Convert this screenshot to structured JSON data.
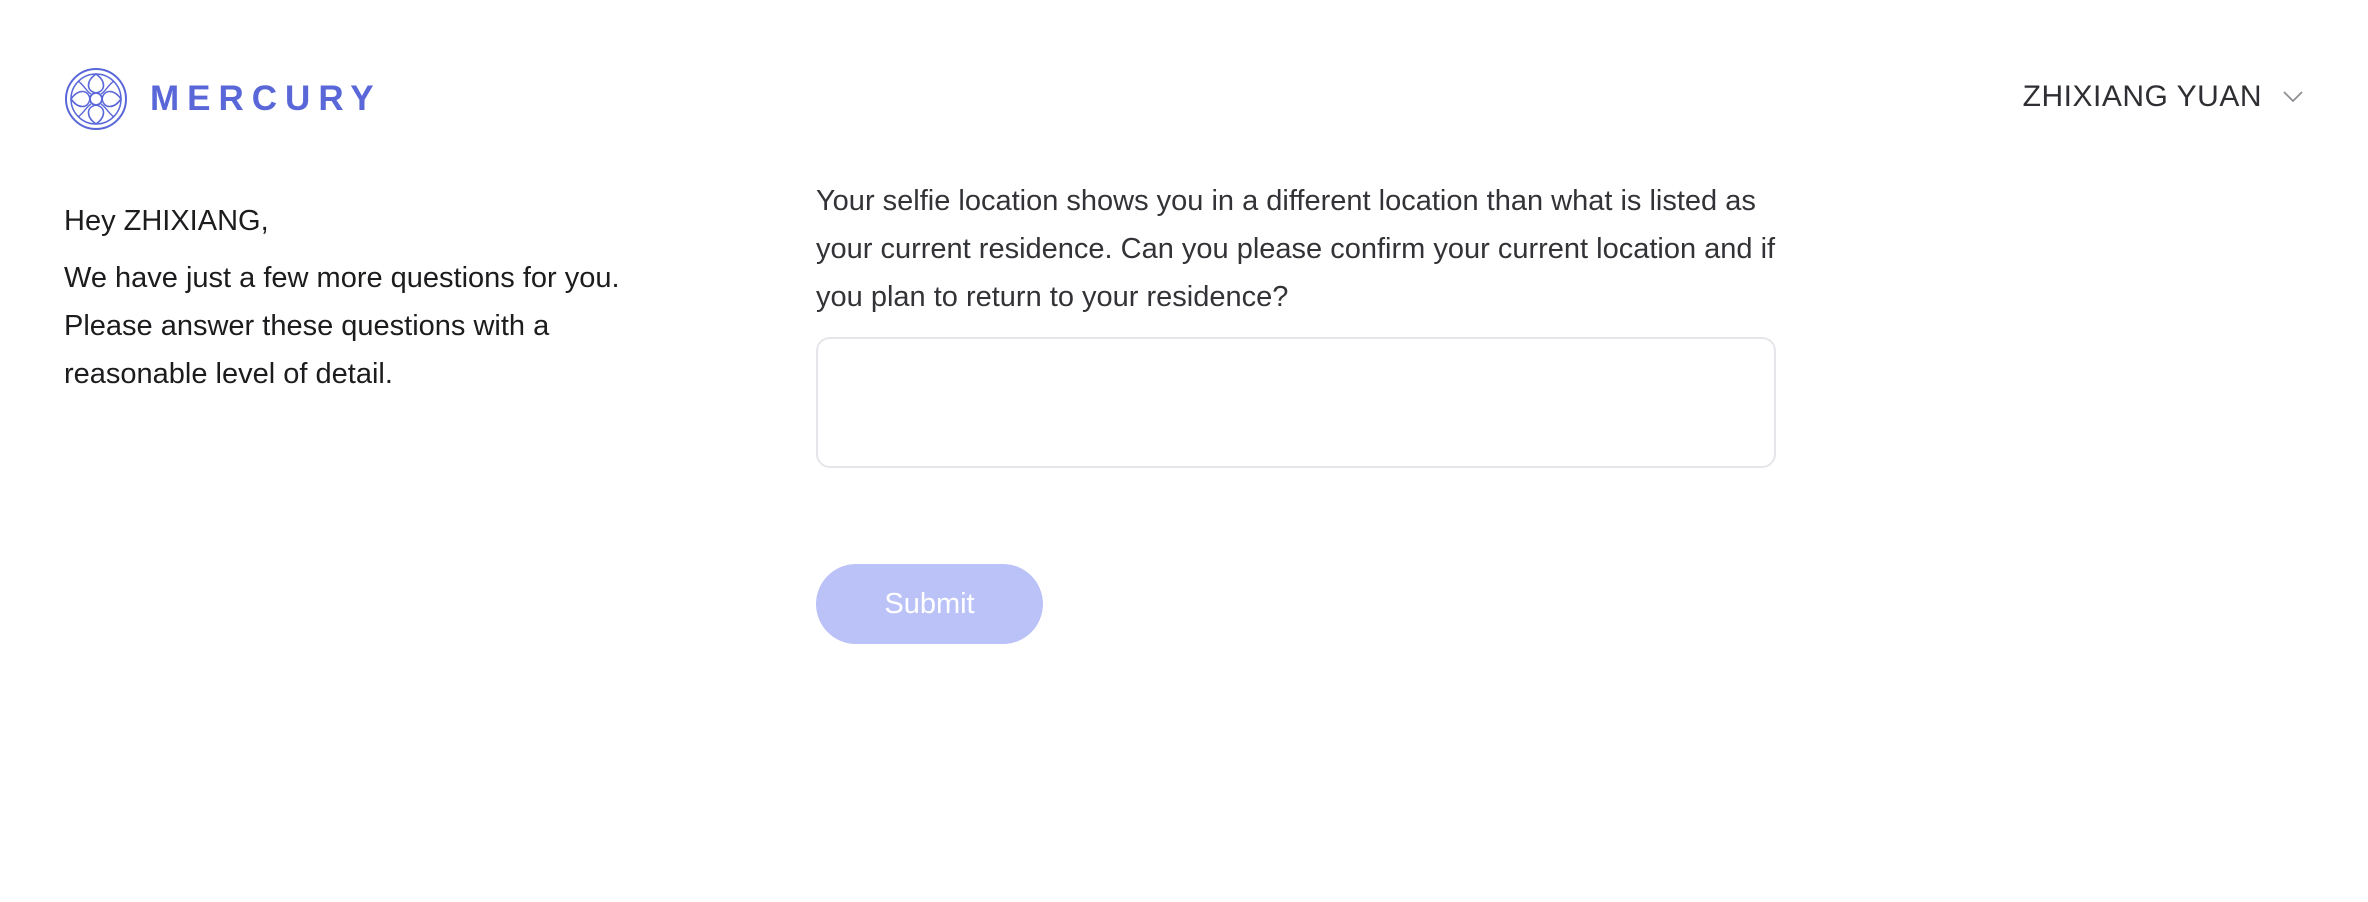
{
  "brand": {
    "name": "MERCURY",
    "accent_color": "#5a67d8",
    "icon": "mercury-logo-icon"
  },
  "user_menu": {
    "name": "ZHIXIANG YUAN",
    "icon": "chevron-down-icon"
  },
  "intro": {
    "greeting": "Hey ZHIXIANG,",
    "message": "We have just a few more questions for you. Please answer these questions with a reasonable level of detail."
  },
  "form": {
    "question": "Your selfie location shows you in a different location than what is listed as your current residence. Can you please confirm your current location and if you plan to return to your residence?",
    "answer_value": "",
    "submit_label": "Submit",
    "submit_color": "#bac2f7"
  }
}
